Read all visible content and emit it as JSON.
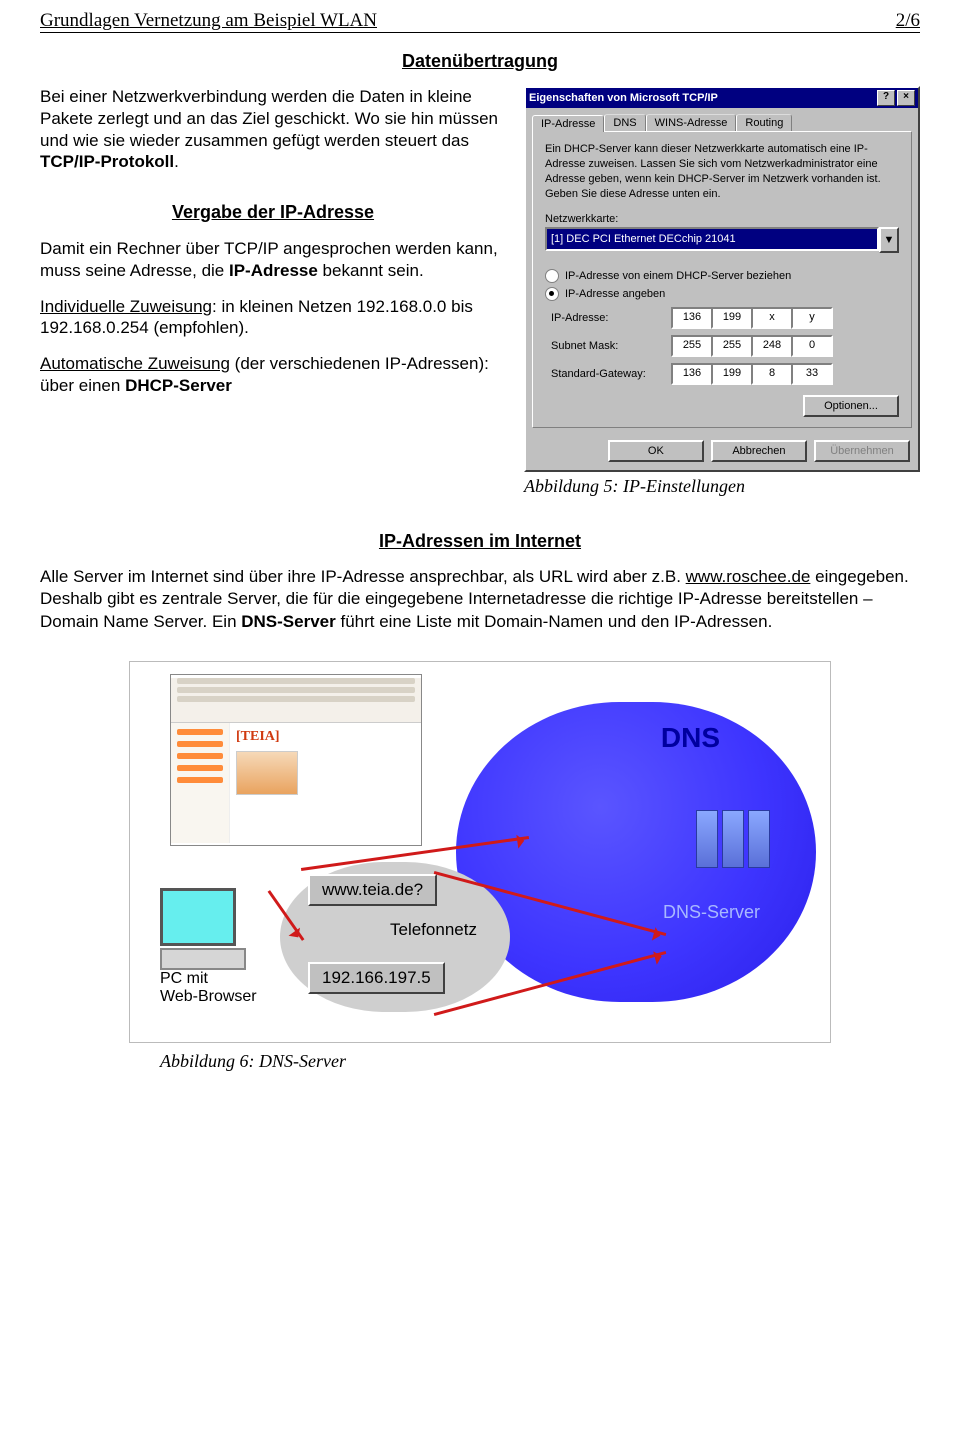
{
  "header": {
    "title": "Grundlagen Vernetzung am Beispiel WLAN",
    "page": "2/6"
  },
  "sec1": {
    "title": "Datenübertragung",
    "p1a": "Bei einer Netzwerkverbindung werden die Daten in kleine Pakete zerlegt und an das Ziel geschickt. Wo sie hin müssen und wie sie wieder zusammen gefügt werden steuert das ",
    "p1b": "TCP/IP-Protokoll",
    "p1c": "."
  },
  "sec2": {
    "title": "Vergabe der IP-Adresse",
    "p1a": "Damit ein Rechner über TCP/IP angesprochen werden kann, muss seine Adresse, die ",
    "p1b": "IP-Adresse",
    "p1c": " bekannt sein.",
    "p2a": "Individuelle Zuweisung",
    "p2b": ": in kleinen Netzen 192.168.0.0 bis 192.168.0.254 (empfohlen).",
    "p3a": "Automatische Zuweisung",
    "p3b": " (der verschiedenen IP-Adressen): über einen ",
    "p3c": "DHCP-Server"
  },
  "dialog": {
    "title": "Eigenschaften von Microsoft TCP/IP",
    "help": "?",
    "close": "×",
    "tabs": [
      "IP-Adresse",
      "DNS",
      "WINS-Adresse",
      "Routing"
    ],
    "hint": "Ein DHCP-Server kann dieser Netzwerkkarte automatisch eine IP-Adresse zuweisen. Lassen Sie sich vom Netzwerkadministrator eine Adresse geben, wenn kein DHCP-Server im Netzwerk vorhanden ist. Geben Sie diese Adresse unten ein.",
    "nic_label": "Netzwerkkarte:",
    "nic_value": "[1] DEC PCI Ethernet DECchip 21041",
    "radio_dhcp": "IP-Adresse von einem DHCP-Server beziehen",
    "radio_manual": "IP-Adresse angeben",
    "ip_row": "IP-Adresse:",
    "ip_vals": [
      "136",
      "199",
      "x",
      "y"
    ],
    "mask_row": "Subnet Mask:",
    "mask_vals": [
      "255",
      "255",
      "248",
      "0"
    ],
    "gw_row": "Standard-Gateway:",
    "gw_vals": [
      "136",
      "199",
      "8",
      "33"
    ],
    "options_btn": "Optionen...",
    "ok": "OK",
    "cancel": "Abbrechen",
    "apply": "Übernehmen",
    "caption": "Abbildung 5: IP-Einstellungen"
  },
  "sec3": {
    "title": "IP-Adressen im Internet",
    "p1a": "Alle Server im Internet sind über ihre IP-Adresse ansprechbar, als URL wird aber z.B. ",
    "p1b": "www.roschee.de",
    "p1c": " eingegeben. Deshalb gibt es zentrale Server, die für die eingegebene Internetadresse die richtige IP-Adresse bereitstellen – Domain Name Server. Ein ",
    "p1d": "DNS-Server",
    "p1e": " führt eine Liste mit Domain-Namen und den IP-Adressen."
  },
  "dnsfig": {
    "teia": "[TEIA]",
    "dns": "DNS",
    "url": "www.teia.de?",
    "tnet": "Telefonnetz",
    "ip": "192.166.197.5",
    "srv": "DNS-Server",
    "pc1": "PC mit",
    "pc2": "Web-Browser",
    "caption": "Abbildung 6: DNS-Server"
  }
}
